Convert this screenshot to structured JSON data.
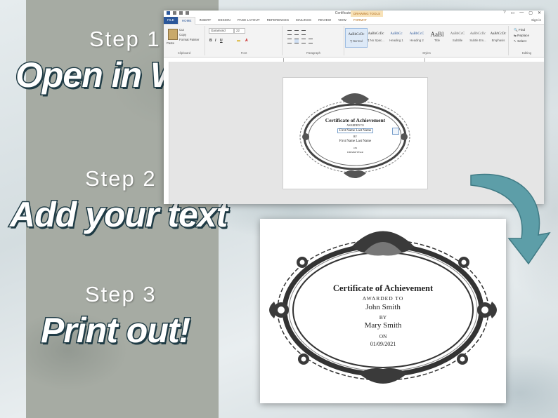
{
  "steps": [
    {
      "label": "Step 1",
      "title": "Open in Word"
    },
    {
      "label": "Step 2",
      "title": "Add your text"
    },
    {
      "label": "Step 3",
      "title": "Print out!"
    }
  ],
  "word": {
    "window_title": "Certificate1.docx - Word",
    "drawing_tools": "DRAWING TOOLS",
    "window_controls": [
      "?",
      "▭",
      "—",
      "▢",
      "✕"
    ],
    "signin": "Sign in",
    "tabs": [
      "FILE",
      "HOME",
      "INSERT",
      "DESIGN",
      "PAGE LAYOUT",
      "REFERENCES",
      "MAILINGS",
      "REVIEW",
      "VIEW",
      "FORMAT"
    ],
    "active_tab": "HOME",
    "clipboard": {
      "paste": "Paste",
      "cut": "Cut",
      "copy": "Copy",
      "format_painter": "Format Painter",
      "label": "Clipboard"
    },
    "font": {
      "name": "Garamond",
      "size": "22",
      "label": "Font"
    },
    "paragraph_label": "Paragraph",
    "styles": [
      {
        "sample": "AaBbCcDc",
        "name": "¶ Normal"
      },
      {
        "sample": "AaBbCcDc",
        "name": "¶ No Spac..."
      },
      {
        "sample": "AaBbCc",
        "name": "Heading 1"
      },
      {
        "sample": "AaBbCcC",
        "name": "Heading 2"
      },
      {
        "sample": "AaBl",
        "name": "Title"
      },
      {
        "sample": "AaBbCcC",
        "name": "Subtitle"
      },
      {
        "sample": "AaBbCcDc",
        "name": "Subtle Em..."
      },
      {
        "sample": "AaBbCcDc",
        "name": "Emphasis"
      }
    ],
    "styles_label": "Styles",
    "editing": {
      "find": "Find",
      "replace": "Replace",
      "select": "Select",
      "label": "Editing"
    },
    "mini_cert": {
      "title": "Certificate of Achievement",
      "awarded_to": "AWARDED TO",
      "recipient": "First Name Last Name",
      "by": "BY",
      "giver": "First Name Last Name",
      "on": "ON",
      "date": "DD/MM/YEAR"
    }
  },
  "printed_cert": {
    "title": "Certificate of Achievement",
    "awarded_to": "AWARDED TO",
    "recipient": "John Smith",
    "by": "BY",
    "giver": "Mary Smith",
    "on": "ON",
    "date": "01/09/2021"
  },
  "colors": {
    "word_blue": "#2b579a",
    "title_stroke": "#1f3b45",
    "arrow": "#5d9ea8",
    "left_panel": "#a6aba3"
  }
}
